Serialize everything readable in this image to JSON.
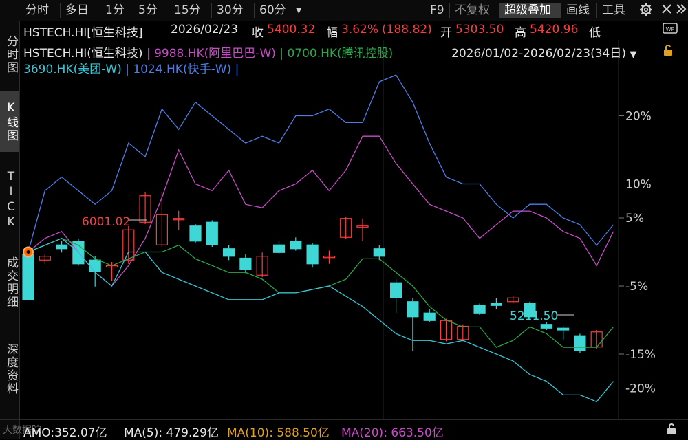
{
  "toolbar": {
    "periods": [
      "分时",
      "多日",
      "1分",
      "5分",
      "15分",
      "30分",
      "60分"
    ],
    "more_arrow": "▾",
    "f9": "F9",
    "no_adjust": "不复权",
    "super_overlay": "超级叠加",
    "draw": "画线",
    "tools": "工具"
  },
  "sidebar": {
    "items": [
      "分时图",
      "K线图",
      "TICK",
      "成交明细",
      "深度资料"
    ]
  },
  "info": {
    "symbol": "HSTECH.HI[恒生科技]",
    "date": "2026/02/23",
    "close_label": "收",
    "close": "5400.32",
    "change_label": "幅",
    "change_pct": "3.62%",
    "change_abs": "(188.82)",
    "open_label": "开",
    "open": "5303.50",
    "high_label": "高",
    "high": "5420.96",
    "low_label": "低"
  },
  "legend": {
    "s0": "HSTECH.HI(恒生科技)",
    "sep": "|",
    "s1": "9988.HK(阿里巴巴-W)",
    "s2": "0700.HK(腾讯控股)",
    "s3": "3690.HK(美团-W)",
    "s4": "1024.HK(快手-W)"
  },
  "date_range": "2026/01/02-2026/02/23(34日)",
  "annotations": {
    "max_label": "6001.02",
    "min_label": "5211.50"
  },
  "bottom": {
    "amo": "AMO:352.07亿",
    "ma5": "MA(5): 479.29亿",
    "ma10": "MA(10): 588.50亿",
    "ma20": "MA(20): 663.50亿",
    "watermark": "大数据院"
  },
  "colors": {
    "up": "#ff3b3b",
    "down": "#3fd6d6",
    "alibaba": "#c84bc8",
    "tencent": "#28a848",
    "meituan": "#36c6d6",
    "kuaishou": "#4a7fe8"
  },
  "chart_data": {
    "type": "line",
    "y_ticks": [
      "20%",
      "10%",
      "5%",
      "-5%",
      "-15%",
      "-20%"
    ],
    "series": [
      {
        "name": "9988.HK(阿里巴巴-W)",
        "values": [
          0,
          2,
          3,
          0,
          -3,
          -5,
          -2,
          2,
          8,
          15,
          10,
          9,
          12,
          7,
          6.5,
          9,
          10,
          12,
          9,
          12,
          17,
          17,
          13,
          10,
          7,
          6,
          5,
          2,
          4,
          6,
          6,
          5,
          3,
          2,
          -2,
          3
        ]
      },
      {
        "name": "0700.HK(腾讯控股)",
        "values": [
          0,
          1,
          2,
          1,
          -1,
          -2,
          -1,
          0,
          0,
          1,
          -1,
          -2,
          -3,
          -3,
          -4,
          -6,
          -6,
          -5.5,
          -5,
          -4,
          -1,
          -1,
          -3,
          -5,
          -8,
          -10,
          -11,
          -11,
          -14,
          -13,
          -11,
          -12,
          -14,
          -14,
          -14,
          -11
        ]
      },
      {
        "name": "3690.HK(美团-W)",
        "values": [
          0,
          1,
          2,
          0,
          -3,
          -5,
          0,
          0,
          -3,
          -4,
          -5,
          -6,
          -7,
          -7,
          -7,
          -6,
          -6,
          -5.5,
          -5,
          -6.5,
          -8,
          -10,
          -12,
          -13,
          -13,
          -13.5,
          -13,
          -14,
          -15,
          -16,
          -18,
          -19,
          -21,
          -21,
          -22,
          -19
        ]
      },
      {
        "name": "1024.HK(快手-W)",
        "values": [
          0,
          9,
          11,
          9,
          7,
          9,
          16,
          14,
          21,
          18,
          22,
          20,
          18,
          16,
          17,
          16,
          20,
          20,
          21,
          19,
          19,
          25,
          26,
          22,
          16,
          11,
          10,
          10,
          7,
          5,
          7,
          7,
          5,
          4,
          1,
          4
        ]
      }
    ],
    "candles": [
      {
        "o": 5305,
        "c": 5185,
        "h": 5305,
        "l": 5185
      },
      {
        "o": 5290,
        "c": 5300,
        "h": 5305,
        "l": 5280
      },
      {
        "o": 5330,
        "c": 5320,
        "h": 5340,
        "l": 5310
      },
      {
        "o": 5340,
        "c": 5280,
        "h": 5345,
        "l": 5275
      },
      {
        "o": 5290,
        "c": 5260,
        "h": 5300,
        "l": 5220
      },
      {
        "o": 5275,
        "c": 5275,
        "h": 5285,
        "l": 5235
      },
      {
        "o": 5290,
        "c": 5370,
        "h": 5380,
        "l": 5280
      },
      {
        "o": 5390,
        "c": 5460,
        "h": 5470,
        "l": 5385
      },
      {
        "o": 5330,
        "c": 5410,
        "h": 5470,
        "l": 5325
      },
      {
        "o": 5400,
        "c": 5400,
        "h": 5420,
        "l": 5370
      },
      {
        "o": 5380,
        "c": 5340,
        "h": 5385,
        "l": 5335
      },
      {
        "o": 5390,
        "c": 5330,
        "h": 5395,
        "l": 5325
      },
      {
        "o": 5320,
        "c": 5300,
        "h": 5330,
        "l": 5290
      },
      {
        "o": 5295,
        "c": 5265,
        "h": 5305,
        "l": 5255
      },
      {
        "o": 5250,
        "c": 5300,
        "h": 5310,
        "l": 5245
      },
      {
        "o": 5330,
        "c": 5310,
        "h": 5340,
        "l": 5305
      },
      {
        "o": 5340,
        "c": 5320,
        "h": 5350,
        "l": 5315
      },
      {
        "o": 5330,
        "c": 5280,
        "h": 5335,
        "l": 5270
      },
      {
        "o": 5300,
        "c": 5300,
        "h": 5315,
        "l": 5280
      },
      {
        "o": 5350,
        "c": 5400,
        "h": 5405,
        "l": 5345
      },
      {
        "o": 5380,
        "c": 5380,
        "h": 5400,
        "l": 5340
      },
      {
        "o": 5320,
        "c": 5300,
        "h": 5330,
        "l": 5290
      },
      {
        "o": 5230,
        "c": 5190,
        "h": 5240,
        "l": 5150
      },
      {
        "o": 5180,
        "c": 5140,
        "h": 5190,
        "l": 5050
      },
      {
        "o": 5150,
        "c": 5130,
        "h": 5160,
        "l": 5125
      },
      {
        "o": 5080,
        "c": 5130,
        "h": 5135,
        "l": 5075
      },
      {
        "o": 5080,
        "c": 5115,
        "h": 5120,
        "l": 5075
      },
      {
        "o": 5170,
        "c": 5150,
        "h": 5175,
        "l": 5145
      },
      {
        "o": 5175,
        "c": 5170,
        "h": 5190,
        "l": 5160
      },
      {
        "o": 5180,
        "c": 5190,
        "h": 5195,
        "l": 5175
      },
      {
        "o": 5175,
        "c": 5140,
        "h": 5180,
        "l": 5135
      },
      {
        "o": 5120,
        "c": 5110,
        "h": 5125,
        "l": 5105
      },
      {
        "o": 5110,
        "c": 5105,
        "h": 5115,
        "l": 5080
      },
      {
        "o": 5090,
        "c": 5050,
        "h": 5095,
        "l": 5045
      },
      {
        "o": 5060,
        "c": 5100,
        "h": 5105,
        "l": 5055
      }
    ]
  }
}
